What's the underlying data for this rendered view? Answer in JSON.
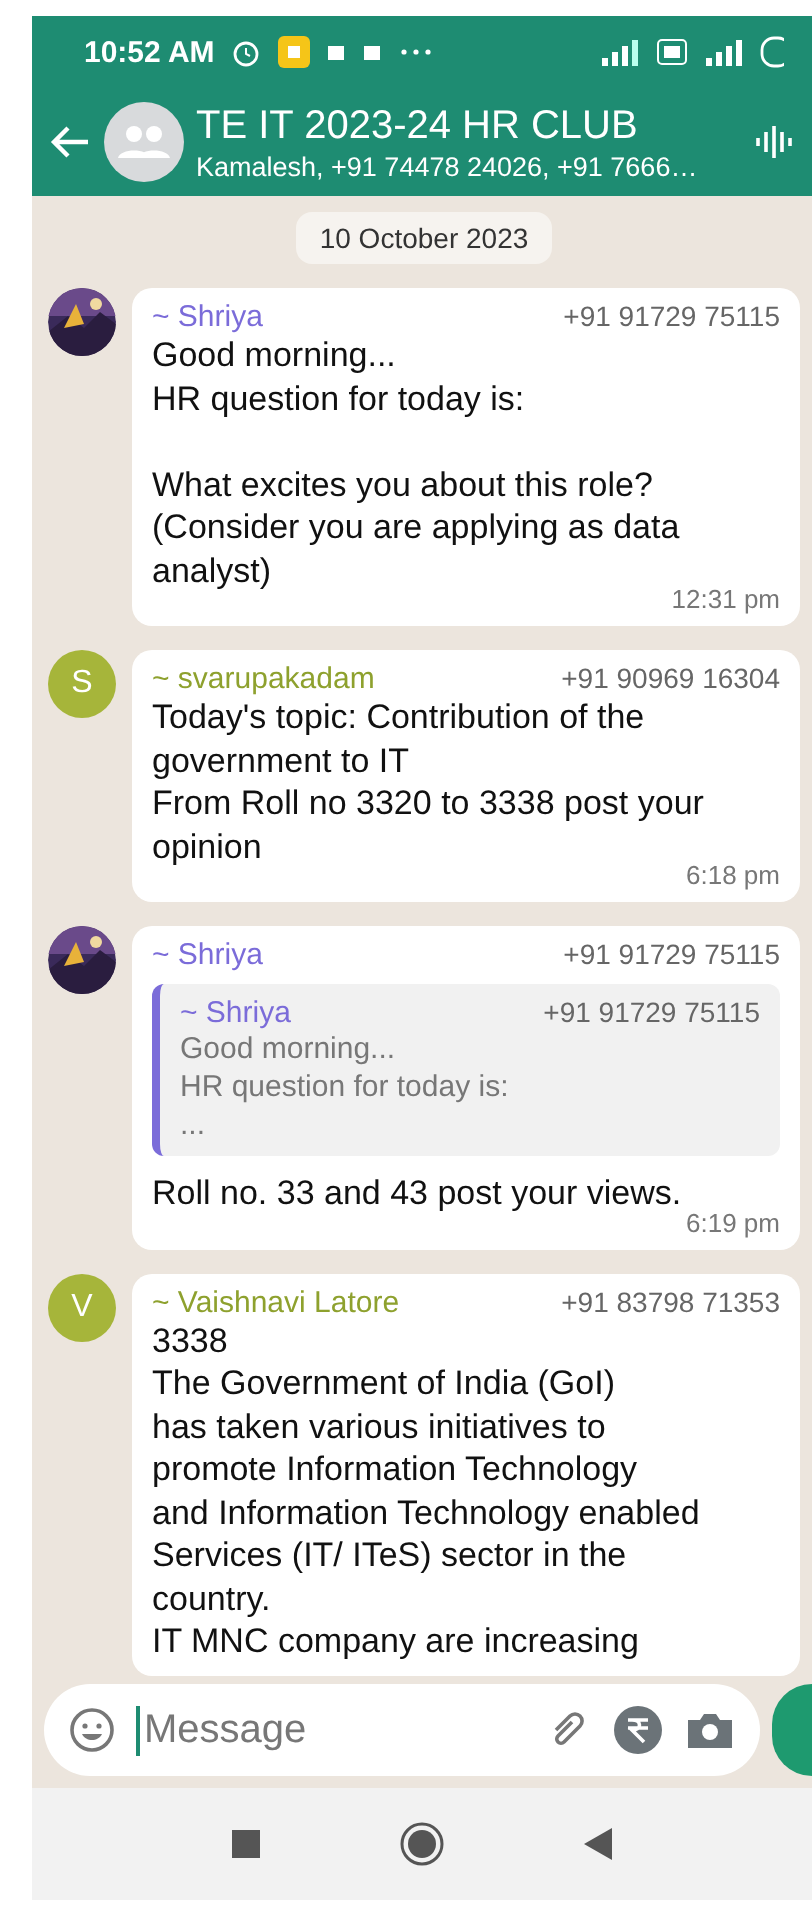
{
  "status_bar": {
    "time": "10:52 AM"
  },
  "header": {
    "title": "TE IT 2023-24 HR CLUB",
    "subtitle": "Kamalesh, +91 74478 24026, +91 7666…"
  },
  "date_chip": "10 October 2023",
  "messages": [
    {
      "kind": "text",
      "sender": "~ Shriya",
      "color": "#7b6cd9",
      "phone": "+91 91729 75115",
      "body": "Good morning...\nHR question for today is:\n\nWhat excites you about this role?\n(Consider you are applying as data\nanalyst)",
      "time": "12:31 pm"
    },
    {
      "kind": "text",
      "avatar": {
        "kind": "letter",
        "letter": "S",
        "color": "#a6b53a"
      },
      "sender": "~ svarupakadam",
      "color": "#8ea12e",
      "phone": "+91 90969 16304",
      "body": "Today's topic: Contribution of the\ngovernment to IT\nFrom Roll no 3320 to 3338 post your\nopinion",
      "time": "6:18 pm"
    },
    {
      "kind": "reply",
      "sender": "~ Shriya",
      "color": "#7b6cd9",
      "phone": "+91 91729 75115",
      "quote": {
        "sender": "~ Shriya",
        "phone": "+91 91729 75115",
        "body": "Good morning...\nHR question for today is:\n..."
      },
      "body": "Roll no. 33 and 43 post your views.",
      "time": "6:19 pm"
    },
    {
      "kind": "text",
      "avatar": {
        "kind": "letter",
        "letter": "V",
        "color": "#a6b53a"
      },
      "sender": "~ Vaishnavi Latore",
      "color": "#8ea12e",
      "phone": "+91 83798 71353",
      "body": "3338\nThe Government of India (GoI)\nhas taken various initiatives to\npromote Information Technology\nand Information Technology enabled\nServices (IT/ ITeS) sector in the\ncountry.\nIT MNC company are increasing"
    }
  ],
  "composer": {
    "placeholder": "Message"
  }
}
